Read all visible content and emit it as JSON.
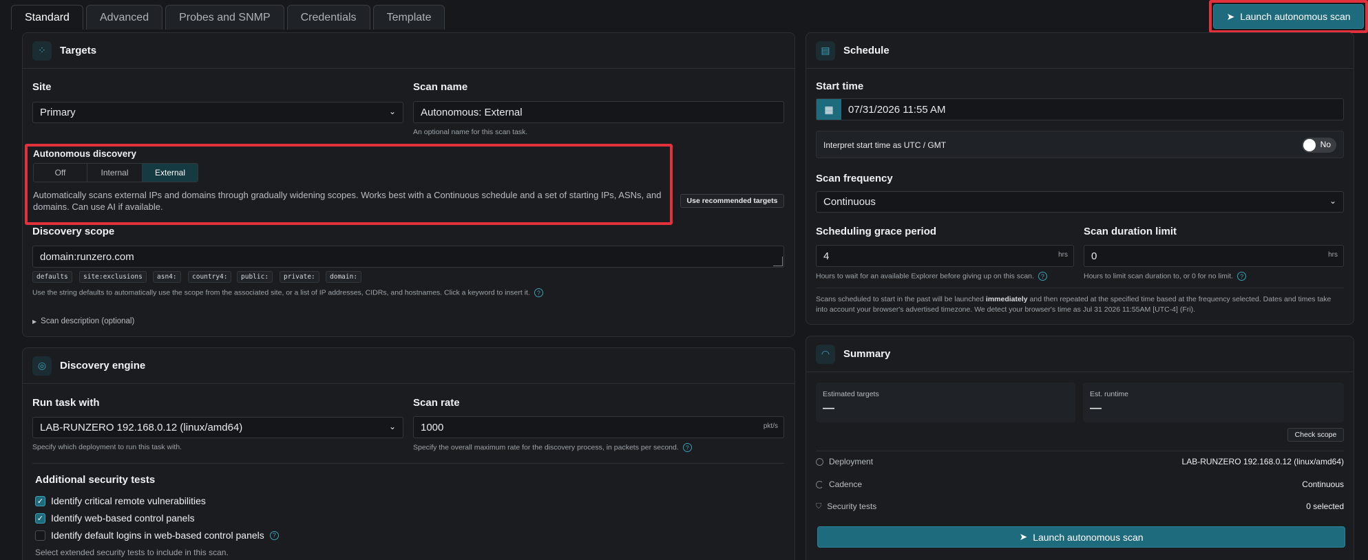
{
  "tabs": [
    "Standard",
    "Advanced",
    "Probes and SNMP",
    "Credentials",
    "Template"
  ],
  "launch_label": "Launch autonomous scan",
  "targets": {
    "title": "Targets",
    "site_label": "Site",
    "site_value": "Primary",
    "scan_name_label": "Scan name",
    "scan_name_value": "Autonomous: External",
    "scan_name_help": "An optional name for this scan task.",
    "autonomous_label": "Autonomous discovery",
    "modes": [
      "Off",
      "Internal",
      "External"
    ],
    "mode_selected": "External",
    "autonomous_desc": "Automatically scans external IPs and domains through gradually widening scopes. Works best with a Continuous schedule and a set of starting IPs, ASNs, and domains. Can use AI if available.",
    "recommended_button": "Use recommended targets",
    "scope_label": "Discovery scope",
    "scope_value": "domain:runzero.com",
    "keywords": [
      "defaults",
      "site:exclusions",
      "asn4:",
      "country4:",
      "public:",
      "private:",
      "domain:"
    ],
    "scope_help": "Use the string defaults to automatically use the scope from the associated site, or a list of IP addresses, CIDRs, and hostnames. Click a keyword to insert it.",
    "description_toggle": "Scan description (optional)"
  },
  "engine": {
    "title": "Discovery engine",
    "run_label": "Run task with",
    "run_value": "LAB-RUNZERO 192.168.0.12 (linux/amd64)",
    "run_help": "Specify which deployment to run this task with.",
    "rate_label": "Scan rate",
    "rate_value": "1000",
    "rate_unit": "pkt/s",
    "rate_help": "Specify the overall maximum rate for the discovery process, in packets per second.",
    "security_label": "Additional security tests",
    "tests": [
      {
        "label": "Identify critical remote vulnerabilities",
        "checked": true
      },
      {
        "label": "Identify web-based control panels",
        "checked": true
      },
      {
        "label": "Identify default logins in web-based control panels",
        "checked": false
      }
    ],
    "security_help": "Select extended security tests to include in this scan."
  },
  "schedule": {
    "title": "Schedule",
    "start_label": "Start time",
    "start_value": "07/31/2026 11:55 AM",
    "utc_label": "Interpret start time as UTC / GMT",
    "utc_toggle": "No",
    "freq_label": "Scan frequency",
    "freq_value": "Continuous",
    "grace_label": "Scheduling grace period",
    "grace_value": "4",
    "grace_unit": "hrs",
    "grace_help": "Hours to wait for an available Explorer before giving up on this scan.",
    "duration_label": "Scan duration limit",
    "duration_value": "0",
    "duration_unit": "hrs",
    "duration_help": "Hours to limit scan duration to, or 0 for no limit.",
    "note_pre": "Scans scheduled to start in the past will be launched ",
    "note_bold": "immediately",
    "note_post": " and then repeated at the specified time based at the frequency selected. Dates and times take into account your browser's advertised timezone. We detect your browser's time as Jul 31 2026 11:55AM [UTC-4] (Fri)."
  },
  "summary": {
    "title": "Summary",
    "est_targets_label": "Estimated targets",
    "est_targets_value": "—",
    "est_runtime_label": "Est. runtime",
    "est_runtime_value": "—",
    "check_scope": "Check scope",
    "rows": [
      {
        "key": "Deployment",
        "value": "LAB-RUNZERO 192.168.0.12 (linux/amd64)"
      },
      {
        "key": "Cadence",
        "value": "Continuous"
      },
      {
        "key": "Security tests",
        "value": "0 selected"
      }
    ]
  },
  "colors": {
    "accent": "#1f6b7e",
    "highlight": "#e2313d",
    "background": "#16181b"
  }
}
